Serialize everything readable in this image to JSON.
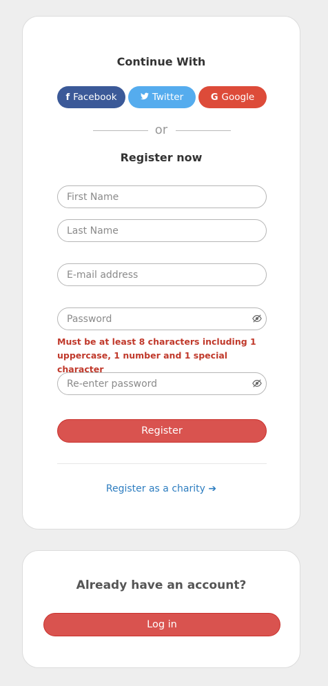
{
  "register_card": {
    "continue_heading": "Continue With",
    "social": {
      "facebook": {
        "icon": "f",
        "label": "Facebook"
      },
      "twitter": {
        "icon": "🐦",
        "label": "Twitter"
      },
      "google": {
        "icon": "G",
        "label": "Google"
      }
    },
    "or_text": "or",
    "register_heading": "Register now",
    "fields": {
      "first_name": {
        "placeholder": "First Name",
        "value": ""
      },
      "last_name": {
        "placeholder": "Last Name",
        "value": ""
      },
      "email": {
        "placeholder": "E-mail address",
        "value": ""
      },
      "password": {
        "placeholder": "Password",
        "value": ""
      },
      "reenter_password": {
        "placeholder": "Re-enter password",
        "value": ""
      }
    },
    "password_error": "Must be at least 8 characters including 1 uppercase, 1 number and 1 special character",
    "register_button": "Register",
    "charity_link": "Register as a charity",
    "charity_arrow": "➔"
  },
  "login_card": {
    "heading": "Already have an account?",
    "login_button": "Log in"
  },
  "colors": {
    "facebook": "#3b5998",
    "twitter": "#55acee",
    "google": "#dd4b39",
    "primary_red": "#d9534f",
    "error": "#c0392b",
    "link": "#2d7dc0"
  }
}
